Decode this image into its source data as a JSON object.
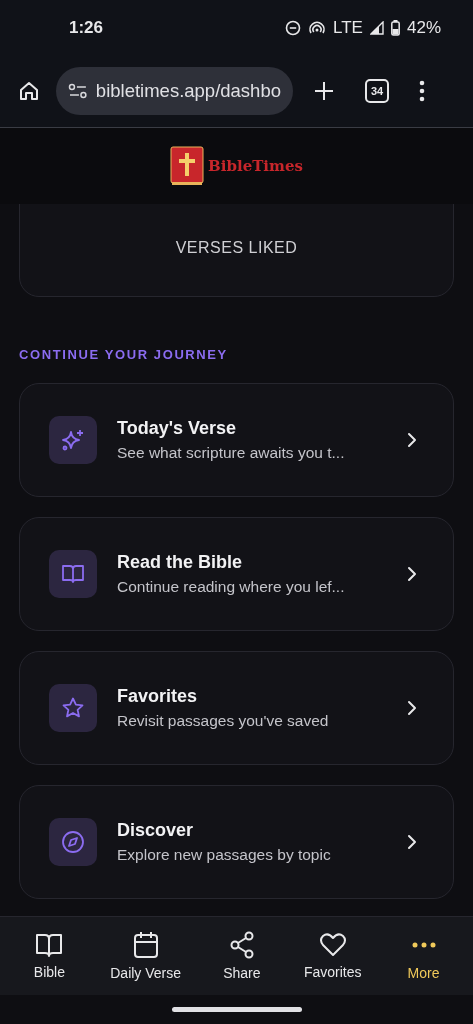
{
  "status_bar": {
    "time": "1:26",
    "network": "LTE",
    "battery": "42%"
  },
  "browser": {
    "url": "bibletimes.app/dashbo",
    "tab_count": "34"
  },
  "header": {
    "brand": "BibleTimes"
  },
  "stat": {
    "label": "VERSES LIKED"
  },
  "section_title": "CONTINUE YOUR JOURNEY",
  "cards": [
    {
      "title": "Today's Verse",
      "subtitle": "See what scripture awaits you t..."
    },
    {
      "title": "Read the Bible",
      "subtitle": "Continue reading where you lef..."
    },
    {
      "title": "Favorites",
      "subtitle": "Revisit passages you've saved"
    },
    {
      "title": "Discover",
      "subtitle": "Explore new passages by topic"
    }
  ],
  "nav": [
    {
      "label": "Bible",
      "selected": false
    },
    {
      "label": "Daily Verse",
      "selected": false
    },
    {
      "label": "Share",
      "selected": false
    },
    {
      "label": "Favorites",
      "selected": false
    },
    {
      "label": "More",
      "selected": true
    }
  ]
}
